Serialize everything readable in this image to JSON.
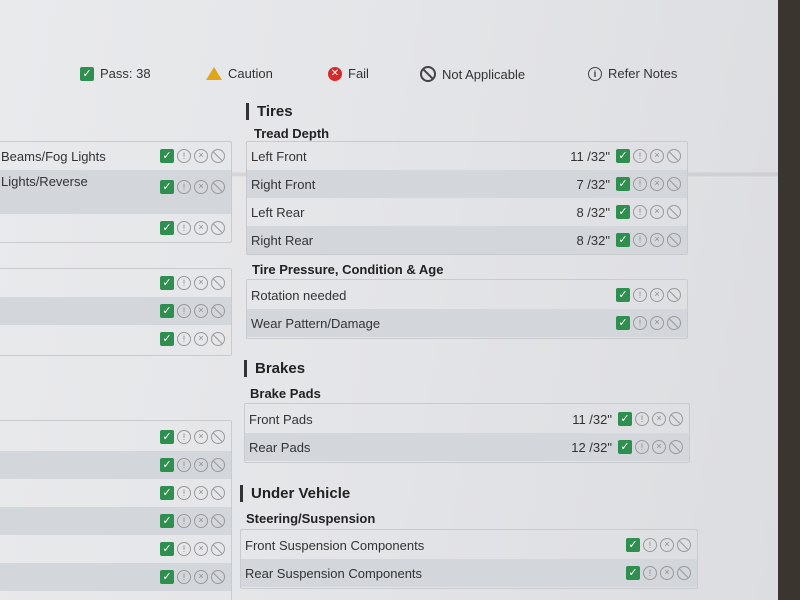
{
  "legend": {
    "pass": "Pass: 38",
    "caution": "Caution",
    "fail": "Fail",
    "not_applicable": "Not Applicable",
    "refer_notes": "Refer Notes"
  },
  "left_column": {
    "rows": [
      {
        "label": "Beams/Fog Lights"
      },
      {
        "label": "Lights/Reverse"
      }
    ]
  },
  "tires": {
    "title": "Tires",
    "tread_depth": {
      "title": "Tread Depth",
      "rows": [
        {
          "label": "Left Front",
          "value": "11 /32\""
        },
        {
          "label": "Right Front",
          "value": "7 /32\""
        },
        {
          "label": "Left Rear",
          "value": "8 /32\""
        },
        {
          "label": "Right Rear",
          "value": "8 /32\""
        }
      ]
    },
    "pressure": {
      "title": "Tire Pressure, Condition & Age",
      "rows": [
        {
          "label": "Rotation needed"
        },
        {
          "label": "Wear Pattern/Damage"
        }
      ]
    }
  },
  "brakes": {
    "title": "Brakes",
    "brake_pads": {
      "title": "Brake Pads",
      "rows": [
        {
          "label": "Front Pads",
          "value": "11 /32\""
        },
        {
          "label": "Rear Pads",
          "value": "12 /32\""
        }
      ]
    }
  },
  "under_vehicle": {
    "title": "Under Vehicle",
    "steering": {
      "title": "Steering/Suspension",
      "rows": [
        {
          "label": "Front Suspension Components"
        },
        {
          "label": "Rear Suspension Components"
        }
      ]
    }
  },
  "icons": {
    "pass": "check-icon",
    "caution": "caution-icon",
    "fail": "fail-icon",
    "not_applicable": "not-applicable-icon",
    "refer_notes": "info-icon"
  },
  "colors": {
    "pass": "#2f8f4e",
    "caution": "#e1a51a",
    "fail": "#d52b2b",
    "row_shade": "#d3d6db"
  }
}
